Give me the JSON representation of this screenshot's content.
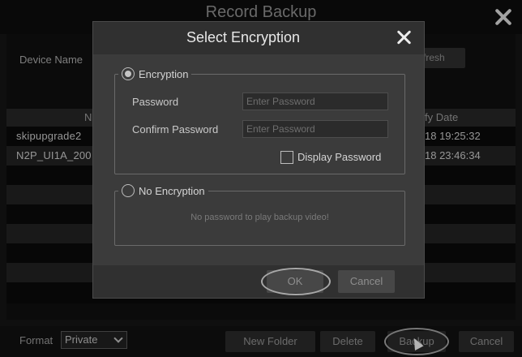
{
  "backup_window": {
    "title": "Record Backup",
    "device_label": "Device Name",
    "refresh_label": "fresh",
    "table": {
      "header_name": "N",
      "header_date": "fy Date",
      "rows": [
        {
          "name": "skipupgrade2",
          "date": "18 19:25:32"
        },
        {
          "name": "N2P_UI1A_200",
          "date": "18 23:46:34"
        }
      ]
    },
    "footer": {
      "format_label": "Format",
      "format_value": "Private",
      "new_folder_label": "New Folder",
      "delete_label": "Delete",
      "backup_label": "Backup",
      "cancel_label": "Cancel"
    }
  },
  "dialog": {
    "title": "Select Encryption",
    "encryption_option": "Encryption",
    "password_label": "Password",
    "password_placeholder": "Enter Password",
    "confirm_label": "Confirm Password",
    "confirm_placeholder": "Enter Password",
    "display_password_label": "Display Password",
    "no_encryption_option": "No Encryption",
    "no_encryption_note": "No password to play backup video!",
    "ok_label": "OK",
    "cancel_label": "Cancel",
    "selected_option": "Encryption"
  }
}
